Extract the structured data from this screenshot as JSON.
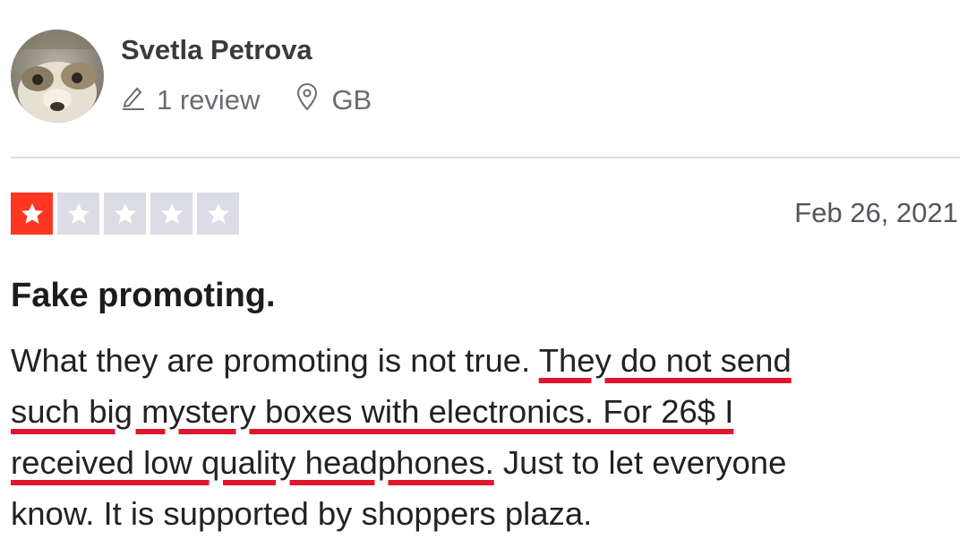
{
  "reviewer": {
    "name": "Svetla Petrova",
    "review_count_text": "1 review",
    "country": "GB",
    "avatar_icon": "reviewer-avatar-photo",
    "pencil_icon": "pencil-icon",
    "location_icon": "location-pin-icon"
  },
  "review": {
    "rating": 1,
    "max_rating": 5,
    "filled_star_color": "#ff3722",
    "empty_star_color": "#dcdce6",
    "underline_color": "#e0162b",
    "date": "Feb 26, 2021",
    "title": "Fake promoting.",
    "body_lines": [
      {
        "plain_before": "What they are promoting is not true. ",
        "highlighted": "They do not send",
        "plain_after": ""
      },
      {
        "plain_before": "",
        "highlighted": "such big mystery boxes with electronics. For 26$ I",
        "plain_after": ""
      },
      {
        "plain_before": "",
        "highlighted": "received low quality headphones.",
        "plain_after": " Just to let everyone"
      },
      {
        "plain_before": "know. It is supported by shoppers plaza.",
        "highlighted": "",
        "plain_after": ""
      }
    ]
  }
}
